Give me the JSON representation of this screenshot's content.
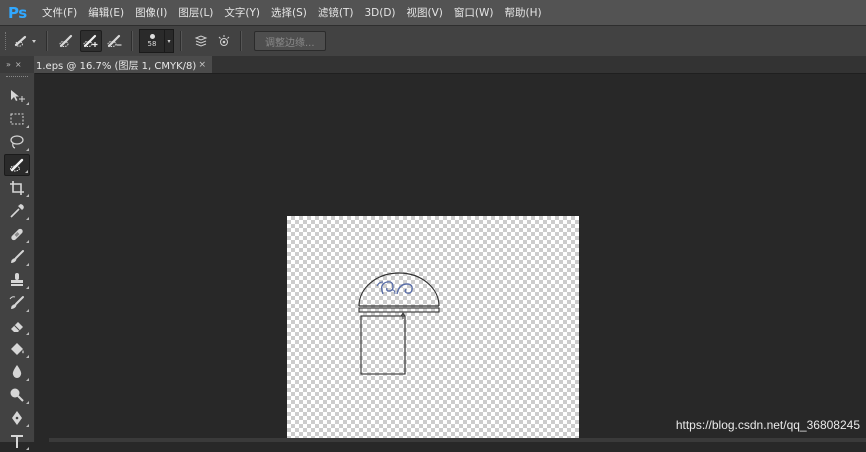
{
  "app": {
    "logo": "Ps",
    "accent": "#31a8ff"
  },
  "menu": {
    "items": [
      {
        "label": "文件(F)"
      },
      {
        "label": "编辑(E)"
      },
      {
        "label": "图像(I)"
      },
      {
        "label": "图层(L)"
      },
      {
        "label": "文字(Y)"
      },
      {
        "label": "选择(S)"
      },
      {
        "label": "滤镜(T)"
      },
      {
        "label": "3D(D)"
      },
      {
        "label": "视图(V)"
      },
      {
        "label": "窗口(W)"
      },
      {
        "label": "帮助(H)"
      }
    ]
  },
  "options": {
    "tool_icon": "quick-selection-icon",
    "modes": [
      "new-selection-icon",
      "add-to-selection-icon",
      "subtract-from-selection-icon"
    ],
    "brush_size": "58",
    "sample_all_layers_icon": "sample-all-layers-icon",
    "auto_enhance_icon": "auto-enhance-icon",
    "refine_edge_label": "调整边缘..."
  },
  "tabs": {
    "panel_toggle": "»",
    "panel_close": "×",
    "document": {
      "title": "1.eps @ 16.7% (图层 1, CMYK/8)",
      "close": "×"
    }
  },
  "tools": [
    {
      "name": "move-tool"
    },
    {
      "name": "marquee-tool"
    },
    {
      "name": "lasso-tool"
    },
    {
      "name": "quick-selection-tool",
      "active": true
    },
    {
      "name": "crop-tool"
    },
    {
      "name": "eyedropper-tool"
    },
    {
      "name": "healing-brush-tool"
    },
    {
      "name": "brush-tool"
    },
    {
      "name": "clone-stamp-tool"
    },
    {
      "name": "history-brush-tool"
    },
    {
      "name": "eraser-tool"
    },
    {
      "name": "paint-bucket-tool"
    },
    {
      "name": "blur-tool"
    },
    {
      "name": "dodge-tool"
    },
    {
      "name": "pen-tool"
    },
    {
      "name": "type-tool"
    }
  ],
  "watermark": "https://blog.csdn.net/qq_36808245"
}
